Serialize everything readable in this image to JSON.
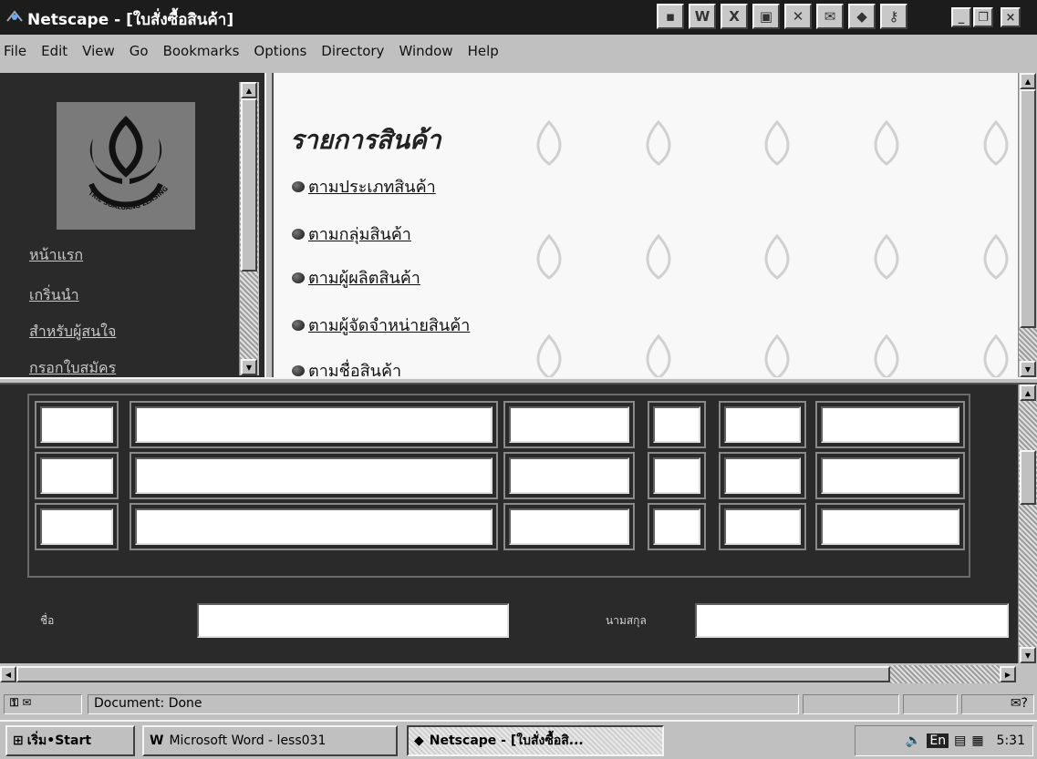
{
  "window": {
    "title": "Netscape - [ใบสั่งซื้อสินค้า]",
    "controls": [
      "_",
      "❐",
      "×"
    ]
  },
  "menu": [
    "File",
    "Edit",
    "View",
    "Go",
    "Bookmarks",
    "Options",
    "Directory",
    "Window",
    "Help"
  ],
  "left_nav": {
    "logo_text": "TRIE SOALUANG LEASING CO., LTD.",
    "links": [
      "หน้าแรก",
      "เกริ่นนำ",
      "สำหรับผู้สนใจ",
      "กรอกใบสมัคร"
    ]
  },
  "catalog": {
    "heading": "รายการสินค้า",
    "links": [
      "ตามประเภทสินค้า",
      "ตามกลุ่มสินค้า",
      "ตามผู้ผลิตสินค้า",
      "ตามผู้จัดจำหน่ายสินค้า",
      "ตามชื่อสินค้า"
    ]
  },
  "form": {
    "rows": 3,
    "first_name_label": "ชื่อ",
    "last_name_label": "นามสกุล"
  },
  "status": {
    "text": "Document: Done"
  },
  "taskbar": {
    "start_label": "เริ่ม•Start",
    "tasks": [
      "Microsoft Word - less031",
      "Netscape - [ใบสั่งซื้อสิ..."
    ],
    "lang": "En",
    "clock": "5:31"
  },
  "colors": {
    "frame_dark": "#2a2a2a",
    "chrome": "#c0c0c0",
    "titlebar": "#1c1c1c"
  }
}
